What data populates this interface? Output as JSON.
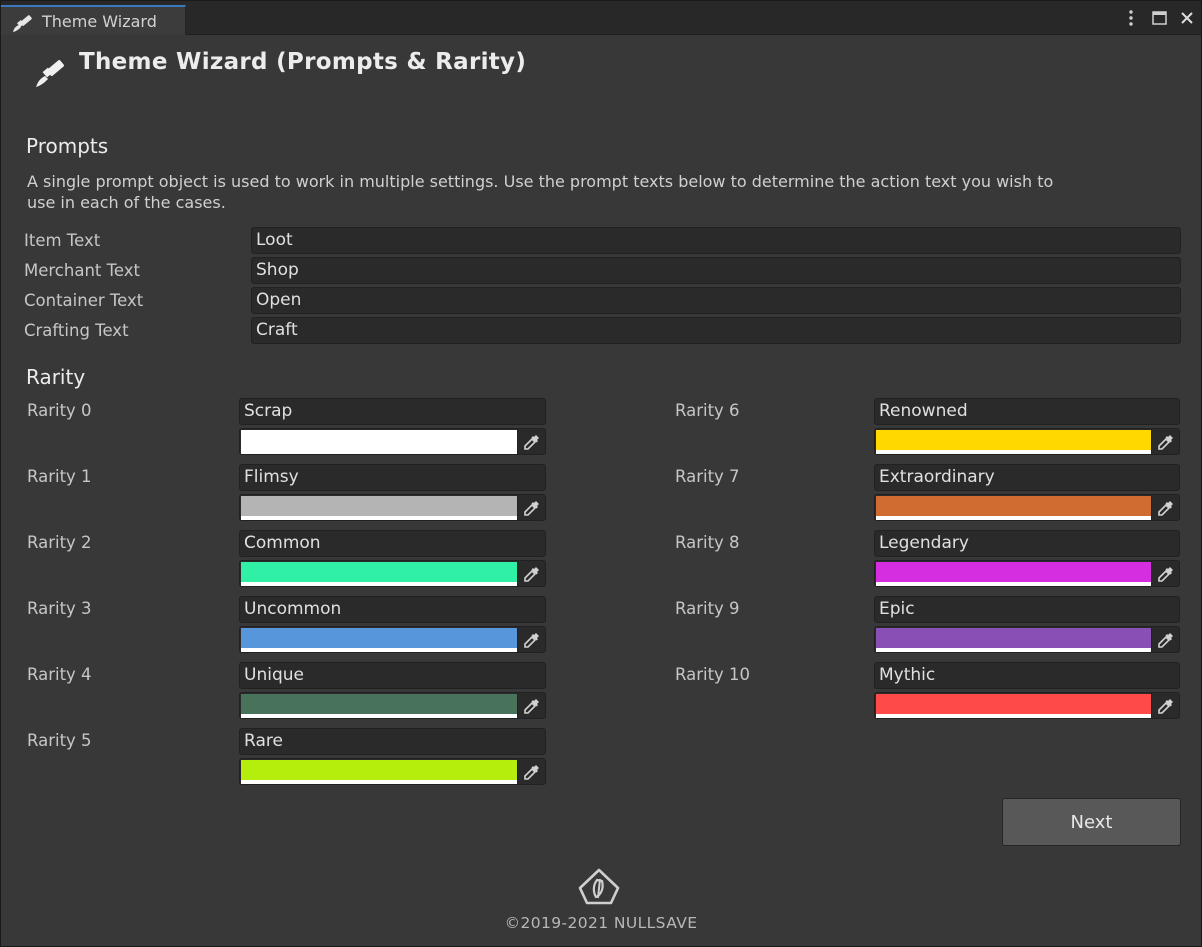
{
  "window": {
    "tab_title": "Theme Wizard",
    "header_title": "Theme Wizard (Prompts & Rarity)",
    "controls": [
      "more-vert-icon",
      "maximize-icon",
      "close-icon"
    ]
  },
  "prompts": {
    "title": "Prompts",
    "description": "A single prompt object is used to work in multiple settings. Use the prompt texts below to determine the action text you wish to use in each of the cases.",
    "fields": [
      {
        "label": "Item Text",
        "value": "Loot"
      },
      {
        "label": "Merchant Text",
        "value": "Shop"
      },
      {
        "label": "Container Text",
        "value": "Open"
      },
      {
        "label": "Crafting Text",
        "value": "Craft"
      }
    ]
  },
  "rarity": {
    "title": "Rarity",
    "items": [
      {
        "label": "Rarity 0",
        "name": "Scrap",
        "color": "#ffffff"
      },
      {
        "label": "Rarity 1",
        "name": "Flimsy",
        "color": "#b4b4b4"
      },
      {
        "label": "Rarity 2",
        "name": "Common",
        "color": "#30f0a6"
      },
      {
        "label": "Rarity 3",
        "name": "Uncommon",
        "color": "#5796da"
      },
      {
        "label": "Rarity 4",
        "name": "Unique",
        "color": "#48735a"
      },
      {
        "label": "Rarity 5",
        "name": "Rare",
        "color": "#b5ee0c"
      },
      {
        "label": "Rarity 6",
        "name": "Renowned",
        "color": "#ffd800"
      },
      {
        "label": "Rarity 7",
        "name": "Extraordinary",
        "color": "#d06b31"
      },
      {
        "label": "Rarity 8",
        "name": "Legendary",
        "color": "#d42ee0"
      },
      {
        "label": "Rarity 9",
        "name": "Epic",
        "color": "#8a4fb5"
      },
      {
        "label": "Rarity 10",
        "name": "Mythic",
        "color": "#ff4a4a"
      }
    ]
  },
  "footer": {
    "next_label": "Next",
    "copyright": "©2019-2021 NULLSAVE"
  }
}
